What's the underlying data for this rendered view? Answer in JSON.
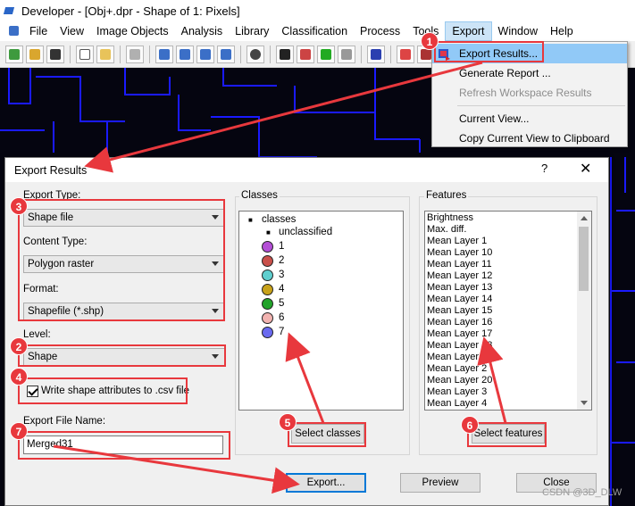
{
  "app": {
    "title": "Developer - [Obj+.dpr - Shape of 1: Pixels]"
  },
  "menubar": {
    "items": [
      "File",
      "View",
      "Image Objects",
      "Analysis",
      "Library",
      "Classification",
      "Process",
      "Tools",
      "Export",
      "Window",
      "Help"
    ]
  },
  "export_menu": {
    "items": [
      {
        "label": "Export Results...",
        "enabled": true,
        "highlighted": true
      },
      {
        "label": "Generate Report ...",
        "enabled": true
      },
      {
        "label": "Refresh Workspace Results",
        "enabled": false
      },
      {
        "label": "Current View...",
        "enabled": true
      },
      {
        "label": "Copy Current View to Clipboard",
        "enabled": true
      }
    ]
  },
  "dialog": {
    "title": "Export Results",
    "help_label": "?",
    "close_label": "✕",
    "export_type_label": "Export Type:",
    "export_type_value": "Shape file",
    "content_type_label": "Content Type:",
    "content_type_value": "Polygon raster",
    "format_label": "Format:",
    "format_value": "Shapefile (*.shp)",
    "level_label": "Level:",
    "level_value": "Shape",
    "write_attrs_label": "Write shape attributes to .csv file",
    "write_attrs_checked": true,
    "file_name_label": "Export File Name:",
    "file_name_value": "Merged31",
    "classes_group": "Classes",
    "classes_root": "classes",
    "unclassified": "unclassified",
    "classes": [
      {
        "name": "1",
        "color": "#b44fd6"
      },
      {
        "name": "2",
        "color": "#c9504a"
      },
      {
        "name": "3",
        "color": "#5fcfcf"
      },
      {
        "name": "4",
        "color": "#c8a21a"
      },
      {
        "name": "5",
        "color": "#22a32a"
      },
      {
        "name": "6",
        "color": "#f2b3b0"
      },
      {
        "name": "7",
        "color": "#6a6af0"
      }
    ],
    "select_classes_label": "Select classes",
    "features_group": "Features",
    "features": [
      "Brightness",
      "Max. diff.",
      "Mean Layer 1",
      "Mean Layer 10",
      "Mean Layer 11",
      "Mean Layer 12",
      "Mean Layer 13",
      "Mean Layer 14",
      "Mean Layer 15",
      "Mean Layer 16",
      "Mean Layer 17",
      "Mean Layer 18",
      "Mean Layer 19",
      "Mean Layer 2",
      "Mean Layer 20",
      "Mean Layer 3",
      "Mean Layer 4"
    ],
    "select_features_label": "Select features",
    "export_label": "Export...",
    "preview_label": "Preview",
    "close_button_label": "Close"
  },
  "annotations": {
    "badges": [
      "1",
      "2",
      "3",
      "4",
      "5",
      "6",
      "7"
    ]
  },
  "watermark": "CSDN @3D_DLW"
}
